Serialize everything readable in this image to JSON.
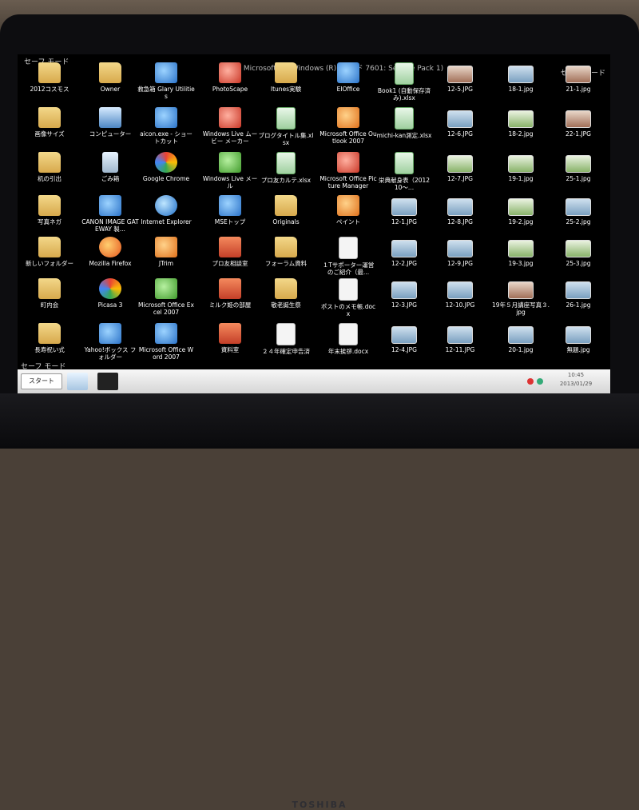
{
  "screen": {
    "title_bar": "Microsoft (R) Windows (R) (ビルド 7601: Service Pack 1)",
    "safe_mode_label": "セーフ モード",
    "brand": "TOSHIBA"
  },
  "columns": [
    [
      {
        "label": "2012コスモス",
        "icon": "folder-icon",
        "kind": "folder"
      },
      {
        "label": "画像サイズ",
        "icon": "folder-icon",
        "kind": "folder"
      },
      {
        "label": "机の引出",
        "icon": "folder-icon",
        "kind": "folder"
      },
      {
        "label": "写真ネガ",
        "icon": "folder-icon",
        "kind": "folder"
      },
      {
        "label": "新しいフォルダー",
        "icon": "folder-icon",
        "kind": "folder"
      },
      {
        "label": "町内会",
        "icon": "folder-icon",
        "kind": "folder"
      },
      {
        "label": "長寿祝い式",
        "icon": "folder-icon",
        "kind": "folder"
      }
    ],
    [
      {
        "label": "Owner",
        "icon": "user-folder-icon",
        "kind": "folder"
      },
      {
        "label": "コンピューター",
        "icon": "computer-icon",
        "kind": "app-cmp"
      },
      {
        "label": "ごみ箱",
        "icon": "recycle-bin-icon",
        "kind": "app-recycle"
      },
      {
        "label": "CANON IMAGE GATEWAY 製...",
        "icon": "canon-icon",
        "kind": "app-blue"
      },
      {
        "label": "Mozilla Firefox",
        "icon": "firefox-icon",
        "kind": "app-ff"
      },
      {
        "label": "Picasa 3",
        "icon": "picasa-icon",
        "kind": "app-multi"
      },
      {
        "label": "Yahoo!ボックス フォルダー",
        "icon": "yahoo-box-icon",
        "kind": "app-blue"
      }
    ],
    [
      {
        "label": "救急箱 Glary Utilities",
        "icon": "glary-utilities-icon",
        "kind": "app-blue"
      },
      {
        "label": "aicon.exe - ショートカット",
        "icon": "at-sign-icon",
        "kind": "app-blue"
      },
      {
        "label": "Google Chrome",
        "icon": "chrome-icon",
        "kind": "app-multi"
      },
      {
        "label": "Internet Explorer",
        "icon": "ie-icon",
        "kind": "app-ie"
      },
      {
        "label": "JTrim",
        "icon": "jtrim-icon",
        "kind": "app-orange"
      },
      {
        "label": "Microsoft Office Excel 2007",
        "icon": "excel-icon",
        "kind": "app-green"
      },
      {
        "label": "Microsoft Office Word 2007",
        "icon": "word-icon",
        "kind": "app-blue"
      }
    ],
    [
      {
        "label": "PhotoScape",
        "icon": "photoscape-icon",
        "kind": "app-red"
      },
      {
        "label": "Windows Live ムービー メーカー",
        "icon": "movie-maker-icon",
        "kind": "app-red"
      },
      {
        "label": "Windows Live メール",
        "icon": "live-mail-icon",
        "kind": "app-green"
      },
      {
        "label": "MSEトップ",
        "icon": "mse-icon",
        "kind": "app-blue"
      },
      {
        "label": "プロ友相談室",
        "icon": "house-icon",
        "kind": "app-house"
      },
      {
        "label": "ミルク姫の部屋",
        "icon": "house-icon",
        "kind": "app-house"
      },
      {
        "label": "資料室",
        "icon": "house-icon",
        "kind": "app-house"
      }
    ],
    [
      {
        "label": "Itunes実験",
        "icon": "folder-icon",
        "kind": "folder"
      },
      {
        "label": "ブログタイトル集.xlsx",
        "icon": "excel-file-icon",
        "kind": "xls"
      },
      {
        "label": "プロ友カルテ.xlsx",
        "icon": "excel-file-icon",
        "kind": "xls"
      },
      {
        "label": "Originals",
        "icon": "folder-icon",
        "kind": "folder"
      },
      {
        "label": "フォーラム資料",
        "icon": "folder-icon",
        "kind": "folder"
      },
      {
        "label": "敬老誕生祭",
        "icon": "folder-icon",
        "kind": "folder"
      },
      {
        "label": "２４年確定申告済",
        "icon": "document-icon",
        "kind": "doc"
      }
    ],
    [
      {
        "label": "EIOffice",
        "icon": "eioffice-icon",
        "kind": "app-blue"
      },
      {
        "label": "Microsoft Office Outlook 2007",
        "icon": "outlook-icon",
        "kind": "app-orange"
      },
      {
        "label": "Microsoft Office Picture Manager",
        "icon": "picture-manager-icon",
        "kind": "app-red"
      },
      {
        "label": "ペイント",
        "icon": "paint-icon",
        "kind": "app-orange"
      },
      {
        "label": "１Tサポーター運営のご紹介（最...",
        "icon": "document-icon",
        "kind": "doc"
      },
      {
        "label": "ポストのメモ帳.docx",
        "icon": "word-file-icon",
        "kind": "doc"
      },
      {
        "label": "年末挨拶.docx",
        "icon": "word-file-icon",
        "kind": "doc"
      }
    ],
    [
      {
        "label": "Book1 (自動保存済み).xlsx",
        "icon": "excel-file-icon",
        "kind": "xls"
      },
      {
        "label": "michi-kan測定.xlsx",
        "icon": "excel-file-icon",
        "kind": "xls"
      },
      {
        "label": "栄典献身表（2012　10～...",
        "icon": "excel-file-icon",
        "kind": "xls"
      },
      {
        "label": "12-1.JPG",
        "icon": "photo-icon",
        "kind": "photo"
      },
      {
        "label": "12-2.JPG",
        "icon": "photo-icon",
        "kind": "photo"
      },
      {
        "label": "12-3.JPG",
        "icon": "photo-icon",
        "kind": "photo"
      },
      {
        "label": "12-4.JPG",
        "icon": "photo-icon",
        "kind": "photo"
      }
    ],
    [
      {
        "label": "12-5.JPG",
        "icon": "photo-icon",
        "kind": "photo3"
      },
      {
        "label": "12-6.JPG",
        "icon": "photo-icon",
        "kind": "photo"
      },
      {
        "label": "12-7.JPG",
        "icon": "photo-icon",
        "kind": "photo2"
      },
      {
        "label": "12-8.JPG",
        "icon": "photo-icon",
        "kind": "photo"
      },
      {
        "label": "12-9.JPG",
        "icon": "photo-icon",
        "kind": "photo"
      },
      {
        "label": "12-10.JPG",
        "icon": "photo-icon",
        "kind": "photo"
      },
      {
        "label": "12-11.JPG",
        "icon": "photo-icon",
        "kind": "photo"
      }
    ],
    [
      {
        "label": "18-1.jpg",
        "icon": "photo-icon",
        "kind": "photo"
      },
      {
        "label": "18-2.jpg",
        "icon": "photo-icon",
        "kind": "photo2"
      },
      {
        "label": "19-1.jpg",
        "icon": "photo-icon",
        "kind": "photo2"
      },
      {
        "label": "19-2.jpg",
        "icon": "photo-icon",
        "kind": "photo2"
      },
      {
        "label": "19-3.jpg",
        "icon": "photo-icon",
        "kind": "photo2"
      },
      {
        "label": "19年５月講座写真３.jpg",
        "icon": "photo-icon",
        "kind": "photo3"
      },
      {
        "label": "20-1.jpg",
        "icon": "photo-icon",
        "kind": "photo"
      }
    ],
    [
      {
        "label": "21-1.jpg",
        "icon": "photo-icon",
        "kind": "photo3"
      },
      {
        "label": "22-1.JPG",
        "icon": "photo-icon",
        "kind": "photo3"
      },
      {
        "label": "25-1.jpg",
        "icon": "photo-icon",
        "kind": "photo2"
      },
      {
        "label": "25-2.jpg",
        "icon": "photo-icon",
        "kind": "photo"
      },
      {
        "label": "25-3.jpg",
        "icon": "photo-icon",
        "kind": "photo2"
      },
      {
        "label": "26-1.jpg",
        "icon": "photo-icon",
        "kind": "photo"
      },
      {
        "label": "無題.jpg",
        "icon": "photo-icon",
        "kind": "photo"
      }
    ]
  ],
  "taskbar": {
    "start_label": "スタート",
    "clock_time": "10:45",
    "clock_date": "2013/01/29"
  }
}
